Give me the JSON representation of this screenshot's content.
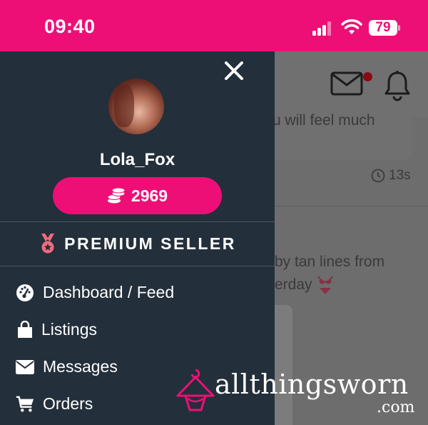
{
  "status": {
    "time": "09:40",
    "battery": "79"
  },
  "drawer": {
    "username": "Lola_Fox",
    "coins": "2969",
    "badge": "PREMIUM SELLER",
    "menu": [
      {
        "label": "Dashboard / Feed",
        "icon": "dashboard-gauge-icon"
      },
      {
        "label": "Listings",
        "icon": "shopping-bag-icon"
      },
      {
        "label": "Messages",
        "icon": "envelope-icon"
      },
      {
        "label": "Orders",
        "icon": "cart-icon"
      }
    ]
  },
  "background": {
    "snippet1": "u will feel much",
    "time_ago": "13s",
    "snippet2": "by tan lines from",
    "snippet3": "erday"
  },
  "watermark": {
    "brand": "allthingsworn",
    "tld": ".com"
  },
  "colors": {
    "accent": "#ee0f76",
    "drawer": "#232f3b",
    "premium_medal": "#f06b7f"
  }
}
